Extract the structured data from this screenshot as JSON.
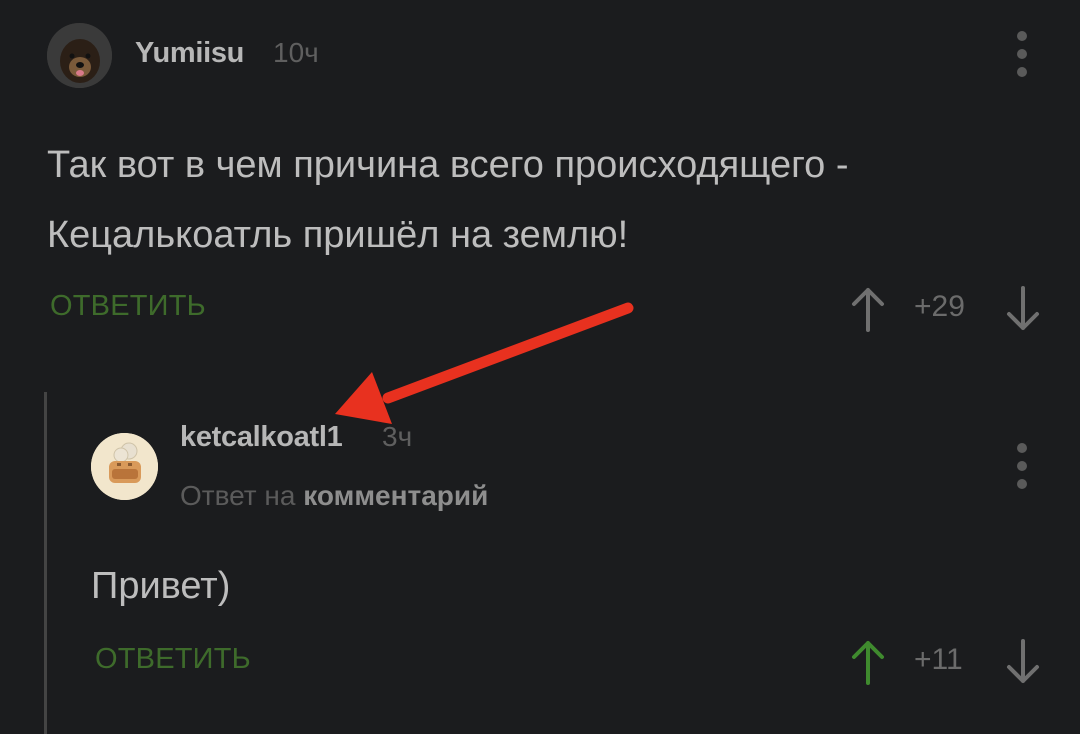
{
  "comment1": {
    "username": "Yumiisu",
    "time": "10ч",
    "text_line1": "Так вот в чем причина всего происходящего -",
    "text_line2": "Кецалькоатль пришёл на землю!",
    "reply_label": "ОТВЕТИТЬ",
    "rating": "+29",
    "up_icon": "arrow-up",
    "down_icon": "arrow-down"
  },
  "comment2": {
    "username": "ketcalkoatl1",
    "time": "3ч",
    "reply_prefix": "Ответ на",
    "reply_target": "комментарий",
    "text": "Привет)",
    "reply_label": "ОТВЕТИТЬ",
    "rating": "+11",
    "upvoted": true
  },
  "colors": {
    "background": "#1b1c1e",
    "accent_green": "#3e6b2b",
    "upvote_active": "#3f8a2e",
    "annotation_arrow": "#e8311f"
  }
}
